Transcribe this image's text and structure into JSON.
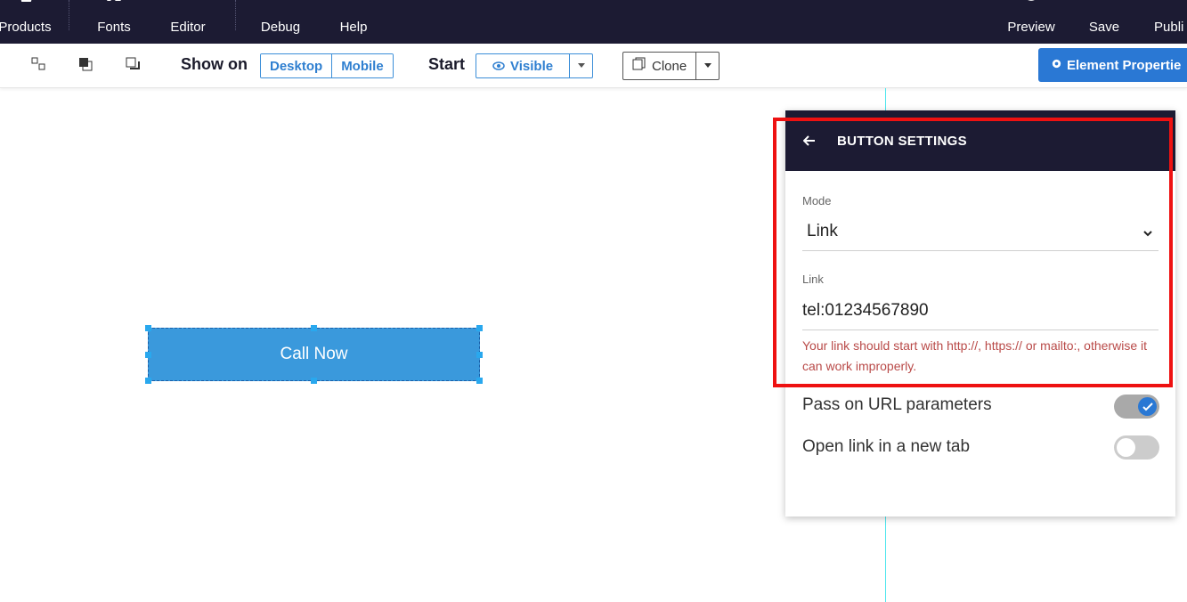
{
  "topnav": {
    "items": [
      {
        "label": "Products",
        "icon": "cart-icon"
      },
      {
        "label": "Fonts",
        "icon": "font-icon"
      },
      {
        "label": "Editor",
        "icon": "layout-icon"
      },
      {
        "label": "Debug",
        "icon": "bug-icon"
      },
      {
        "label": "Help",
        "icon": "info-icon"
      },
      {
        "label": "Preview",
        "icon": "eye-icon"
      },
      {
        "label": "Save",
        "icon": "floppy-icon"
      },
      {
        "label": "Publi",
        "icon": "publish-icon"
      }
    ]
  },
  "toolbar": {
    "show_on_label": "Show on",
    "show_on_options": [
      "Desktop",
      "Mobile"
    ],
    "start_label": "Start",
    "visibility_value": "Visible",
    "clone_label": "Clone",
    "element_properties_label": "Element Propertie"
  },
  "canvas": {
    "button_label": "Call Now"
  },
  "panel": {
    "title": "BUTTON SETTINGS",
    "mode_label": "Mode",
    "mode_value": "Link",
    "link_label": "Link",
    "link_value": "tel:01234567890",
    "warning": "Your link should start with http://, https:// or mailto:, otherwise it can work improperly.",
    "pass_params_label": "Pass on URL parameters",
    "pass_params_on": true,
    "new_tab_label": "Open link in a new tab",
    "new_tab_on": false
  },
  "colors": {
    "nav_bg": "#1c1b33",
    "accent": "#2a78d4",
    "button_bg": "#3a99dc",
    "highlight": "#ee1111",
    "warning": "#b94a48"
  }
}
